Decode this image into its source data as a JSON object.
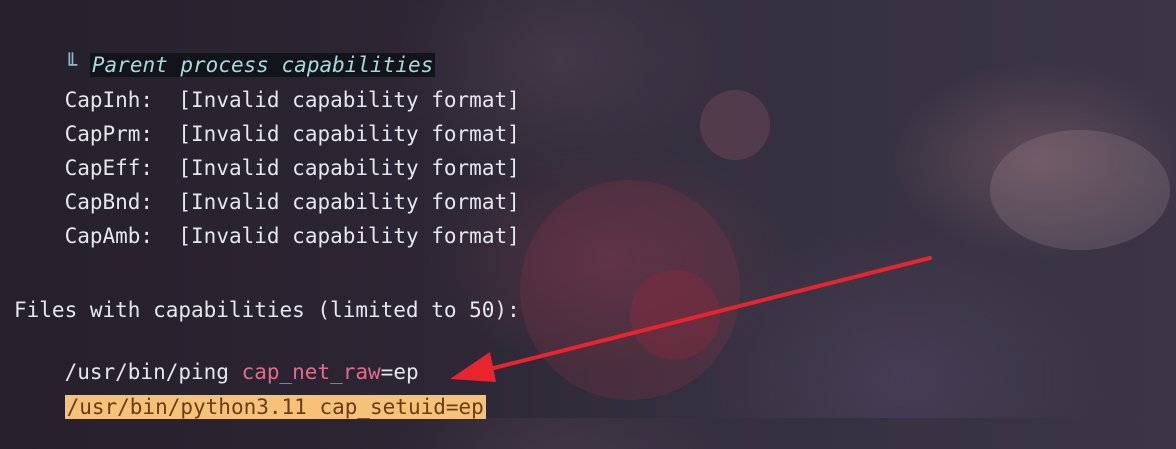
{
  "terminal": {
    "section_glyph": "╙",
    "section_title": "Parent process capabilities",
    "capabilities": [
      {
        "name": "CapInh:",
        "value": "[Invalid capability format]"
      },
      {
        "name": "CapPrm:",
        "value": "[Invalid capability format]"
      },
      {
        "name": "CapEff:",
        "value": "[Invalid capability format]"
      },
      {
        "name": "CapBnd:",
        "value": "[Invalid capability format]"
      },
      {
        "name": "CapAmb:",
        "value": "[Invalid capability format]"
      }
    ],
    "files_header": "Files with capabilities (limited to 50):",
    "files": [
      {
        "path": "/usr/bin/ping ",
        "cap": "cap_net_raw",
        "suffix": "=ep"
      },
      {
        "path": "/usr/bin/python3.11 cap_setuid=ep"
      }
    ]
  },
  "colors": {
    "accent_arrow": "#e8252f",
    "highlight_bg": "#f6c27a",
    "cap_key": "#e06c8c"
  }
}
